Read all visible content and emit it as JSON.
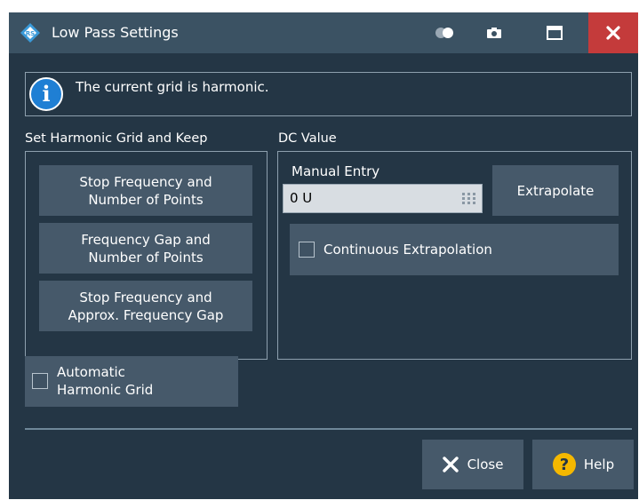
{
  "window": {
    "title": "Low Pass Settings"
  },
  "info": {
    "text": "The current grid is harmonic."
  },
  "harmonic_grid": {
    "label": "Set Harmonic Grid and Keep",
    "buttons": [
      {
        "line1": "Stop Frequency and",
        "line2": "Number of Points"
      },
      {
        "line1": "Frequency Gap and",
        "line2": "Number of Points"
      },
      {
        "line1": "Stop Frequency and",
        "line2": "Approx. Frequency Gap"
      }
    ]
  },
  "dc_value": {
    "label": "DC Value",
    "manual_entry_label": "Manual Entry",
    "manual_entry_value": "0 U",
    "extrapolate_label": "Extrapolate",
    "continuous_label": "Continuous Extrapolation",
    "continuous_checked": false
  },
  "automatic": {
    "line1": "Automatic",
    "line2": "Harmonic Grid",
    "checked": false
  },
  "footer": {
    "close_label": "Close",
    "help_label": "Help"
  },
  "colors": {
    "titlebar": "#3b5263",
    "body": "#243645",
    "button": "#46596a",
    "close": "#c43b3b",
    "info": "#1f7fd4",
    "help": "#f5b800"
  },
  "icons": [
    "rs-logo-icon",
    "toggle-icon",
    "camera-icon",
    "maximize-icon",
    "close-icon",
    "info-icon",
    "keypad-icon",
    "x-icon",
    "help-icon"
  ]
}
